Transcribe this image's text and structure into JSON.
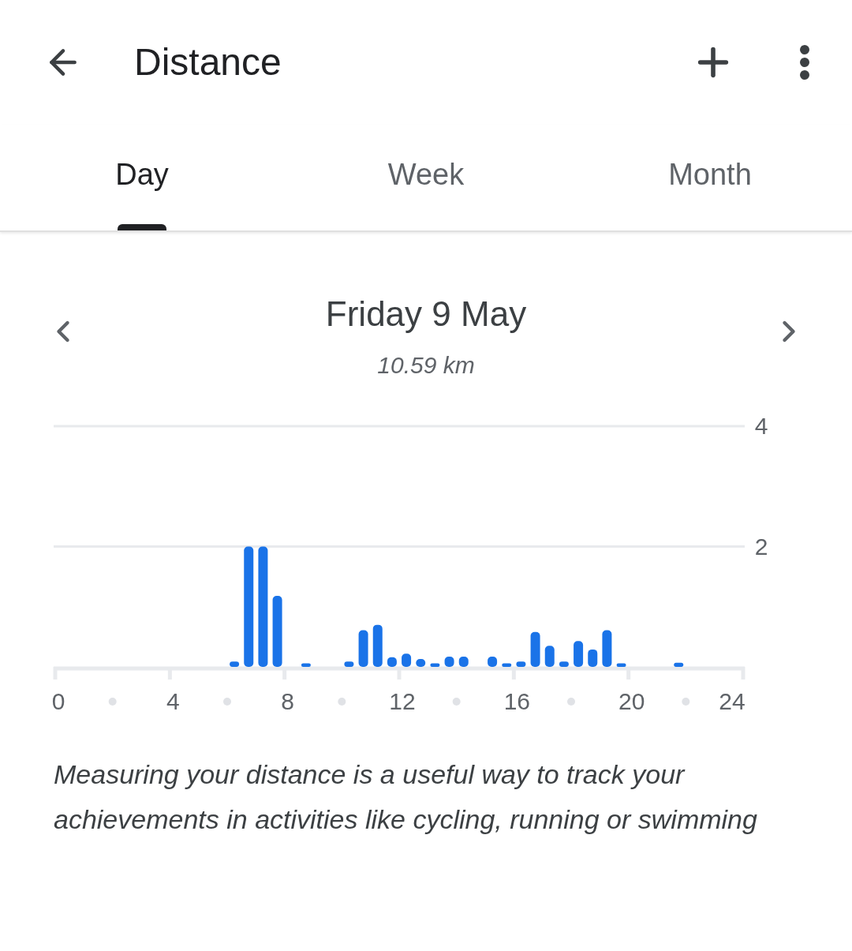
{
  "app_bar": {
    "title": "Distance"
  },
  "tabs": [
    {
      "label": "Day",
      "selected": true
    },
    {
      "label": "Week",
      "selected": false
    },
    {
      "label": "Month",
      "selected": false
    }
  ],
  "date_nav": {
    "date": "Friday 9 May",
    "total": "10.59 km"
  },
  "chart_data": {
    "type": "bar",
    "x": [
      6.25,
      6.75,
      7.25,
      7.75,
      8.75,
      10.25,
      10.75,
      11.25,
      11.75,
      12.25,
      12.75,
      13.25,
      13.75,
      14.25,
      15.25,
      15.75,
      16.25,
      16.75,
      17.25,
      17.75,
      18.25,
      18.75,
      19.25,
      19.75,
      21.75
    ],
    "values": [
      0.09,
      2.0,
      2.0,
      1.18,
      0.06,
      0.09,
      0.61,
      0.7,
      0.16,
      0.22,
      0.13,
      0.06,
      0.17,
      0.17,
      0.17,
      0.06,
      0.09,
      0.58,
      0.35,
      0.09,
      0.43,
      0.29,
      0.61,
      0.06,
      0.07
    ],
    "xlim": [
      0,
      24
    ],
    "ylim": [
      0,
      4
    ],
    "xticks": [
      0,
      4,
      8,
      12,
      16,
      20,
      24
    ],
    "yticks": [
      2,
      4
    ]
  },
  "description": "Measuring your distance is a useful way to track your achievements in activities like cycling, running or swimming"
}
